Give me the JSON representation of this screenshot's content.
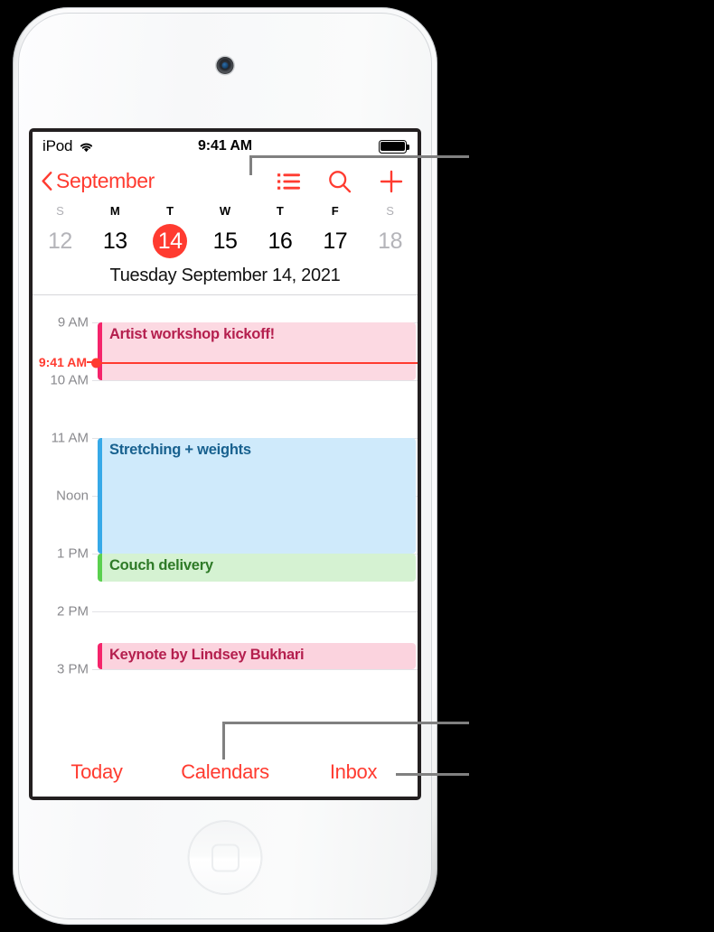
{
  "device": {
    "type": "ipod-touch",
    "camera": "front-camera",
    "home_button": "home-button"
  },
  "status_bar": {
    "carrier": "iPod",
    "wifi_icon": "wifi-icon",
    "time": "9:41 AM",
    "battery_icon": "battery-full-icon"
  },
  "nav_bar": {
    "back_icon": "chevron-left-icon",
    "back_label": "September",
    "list_icon": "list-view-icon",
    "search_icon": "search-icon",
    "add_icon": "plus-icon"
  },
  "week_strip": {
    "day_initials": [
      "S",
      "M",
      "T",
      "W",
      "T",
      "F",
      "S"
    ],
    "dates": [
      {
        "num": "12",
        "state": "dim"
      },
      {
        "num": "13",
        "state": "normal"
      },
      {
        "num": "14",
        "state": "today"
      },
      {
        "num": "15",
        "state": "normal"
      },
      {
        "num": "16",
        "state": "normal"
      },
      {
        "num": "17",
        "state": "normal"
      },
      {
        "num": "18",
        "state": "dim"
      }
    ],
    "selected_full_date": "Tuesday  September 14, 2021",
    "today_highlight_color": "#ff3b30"
  },
  "timeline": {
    "hours": [
      "9 AM",
      "10 AM",
      "11 AM",
      "Noon",
      "1 PM",
      "2 PM",
      "3 PM"
    ],
    "current_time_label": "9:41 AM",
    "current_time_color": "#ff3b30",
    "events": [
      {
        "title": "Artist workshop kickoff!",
        "start": "9 AM",
        "end": "10 AM",
        "fill": "#fcd9e2",
        "bar": "#f5246b",
        "text": "#b41f4e"
      },
      {
        "title": "Stretching + weights",
        "start": "11 AM",
        "end": "1 PM",
        "fill": "#cfeafb",
        "bar": "#36a9e8",
        "text": "#18618f"
      },
      {
        "title": "Couch delivery",
        "start": "1 PM",
        "end": "1:30 PM",
        "fill": "#d5f2d2",
        "bar": "#5ad04e",
        "text": "#2e7a27"
      },
      {
        "title": "Keynote by Lindsey Bukhari",
        "start": "2:30 PM",
        "end": "3 PM",
        "fill": "#fbd3de",
        "bar": "#f5246b",
        "text": "#b41f4e"
      },
      {
        "title": "",
        "start": "",
        "end": "",
        "fill": "#e6f7e3",
        "bar": "#5ad04e",
        "text": "#2e7a27"
      },
      {
        "title": "",
        "start": "",
        "end": "",
        "fill": "#fdf3d8",
        "bar": "#f0a817",
        "text": "#8a6208"
      }
    ]
  },
  "tab_bar": {
    "items": [
      {
        "label": "Today",
        "name": "tab-today"
      },
      {
        "label": "Calendars",
        "name": "tab-calendars"
      },
      {
        "label": "Inbox",
        "name": "tab-inbox"
      }
    ],
    "tint": "#ff3b30"
  },
  "callouts": {
    "line_color": "#808080",
    "targets": [
      "list-view-icon",
      "tab-calendars",
      "tab-inbox"
    ]
  }
}
